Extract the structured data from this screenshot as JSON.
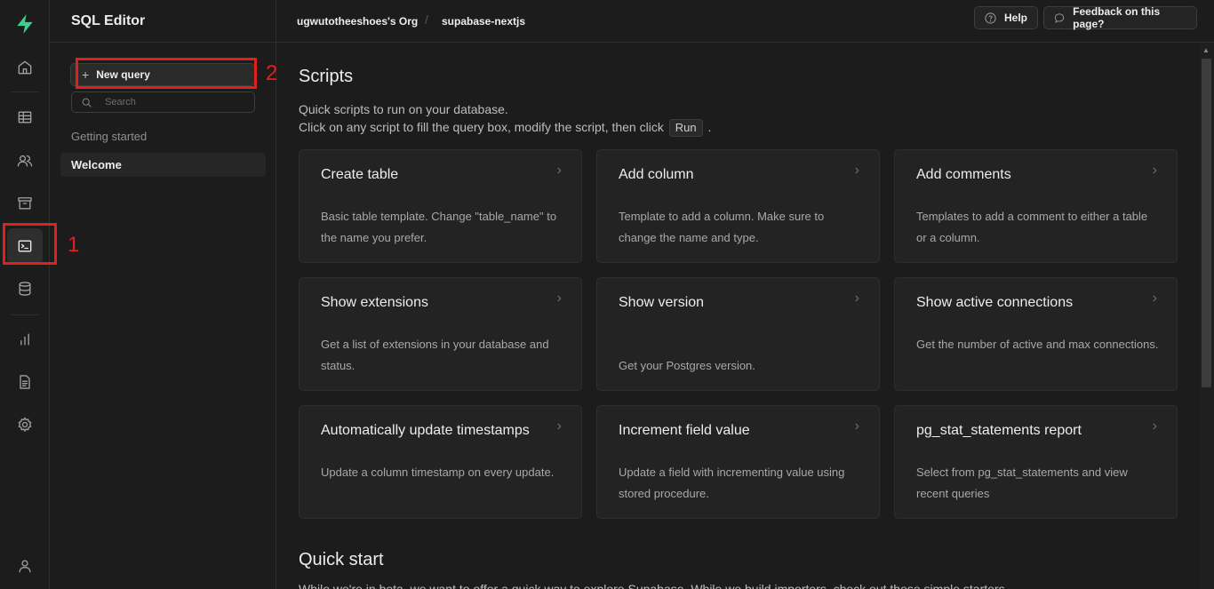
{
  "sidebar": {
    "title": "SQL Editor",
    "new_query_label": "New query",
    "search_placeholder": "Search",
    "section_label": "Getting started",
    "active_item": "Welcome"
  },
  "topbar": {
    "org": "ugwutotheeshoes's Org",
    "separator": "/",
    "project": "supabase-nextjs",
    "help_label": "Help",
    "feedback_label": "Feedback on this page?"
  },
  "scripts": {
    "heading": "Scripts",
    "description_line1": "Quick scripts to run on your database.",
    "description_line2_pre": "Click on any script to fill the query box, modify the script, then click",
    "run_label": "Run",
    "description_line2_post": ".",
    "cards": [
      {
        "title": "Create table",
        "body": "Basic table template. Change \"table_name\" to the name you prefer."
      },
      {
        "title": "Add column",
        "body": "Template to add a column. Make sure to change the name and type."
      },
      {
        "title": "Add comments",
        "body": "Templates to add a comment to either a table or a column."
      },
      {
        "title": "Show extensions",
        "body": "Get a list of extensions in your database and status."
      },
      {
        "title": "Show version",
        "body": "Get your Postgres version."
      },
      {
        "title": "Show active connections",
        "body": "Get the number of active and max connections."
      },
      {
        "title": "Automatically update timestamps",
        "body": "Update a column timestamp on every update."
      },
      {
        "title": "Increment field value",
        "body": "Update a field with incrementing value using stored procedure."
      },
      {
        "title": "pg_stat_statements report",
        "body": "Select from pg_stat_statements and view recent queries"
      }
    ],
    "chevron": "›"
  },
  "quick_start": {
    "heading": "Quick start",
    "description": "While we're in beta, we want to offer a quick way to explore Supabase. While we build importers, check out these simple starters."
  },
  "annotations": {
    "marker_1": "1",
    "marker_2": "2",
    "color": "#e0201d"
  },
  "colors": {
    "brand": "#3ecf8e",
    "background": "#1c1c1c",
    "card": "#232323"
  }
}
